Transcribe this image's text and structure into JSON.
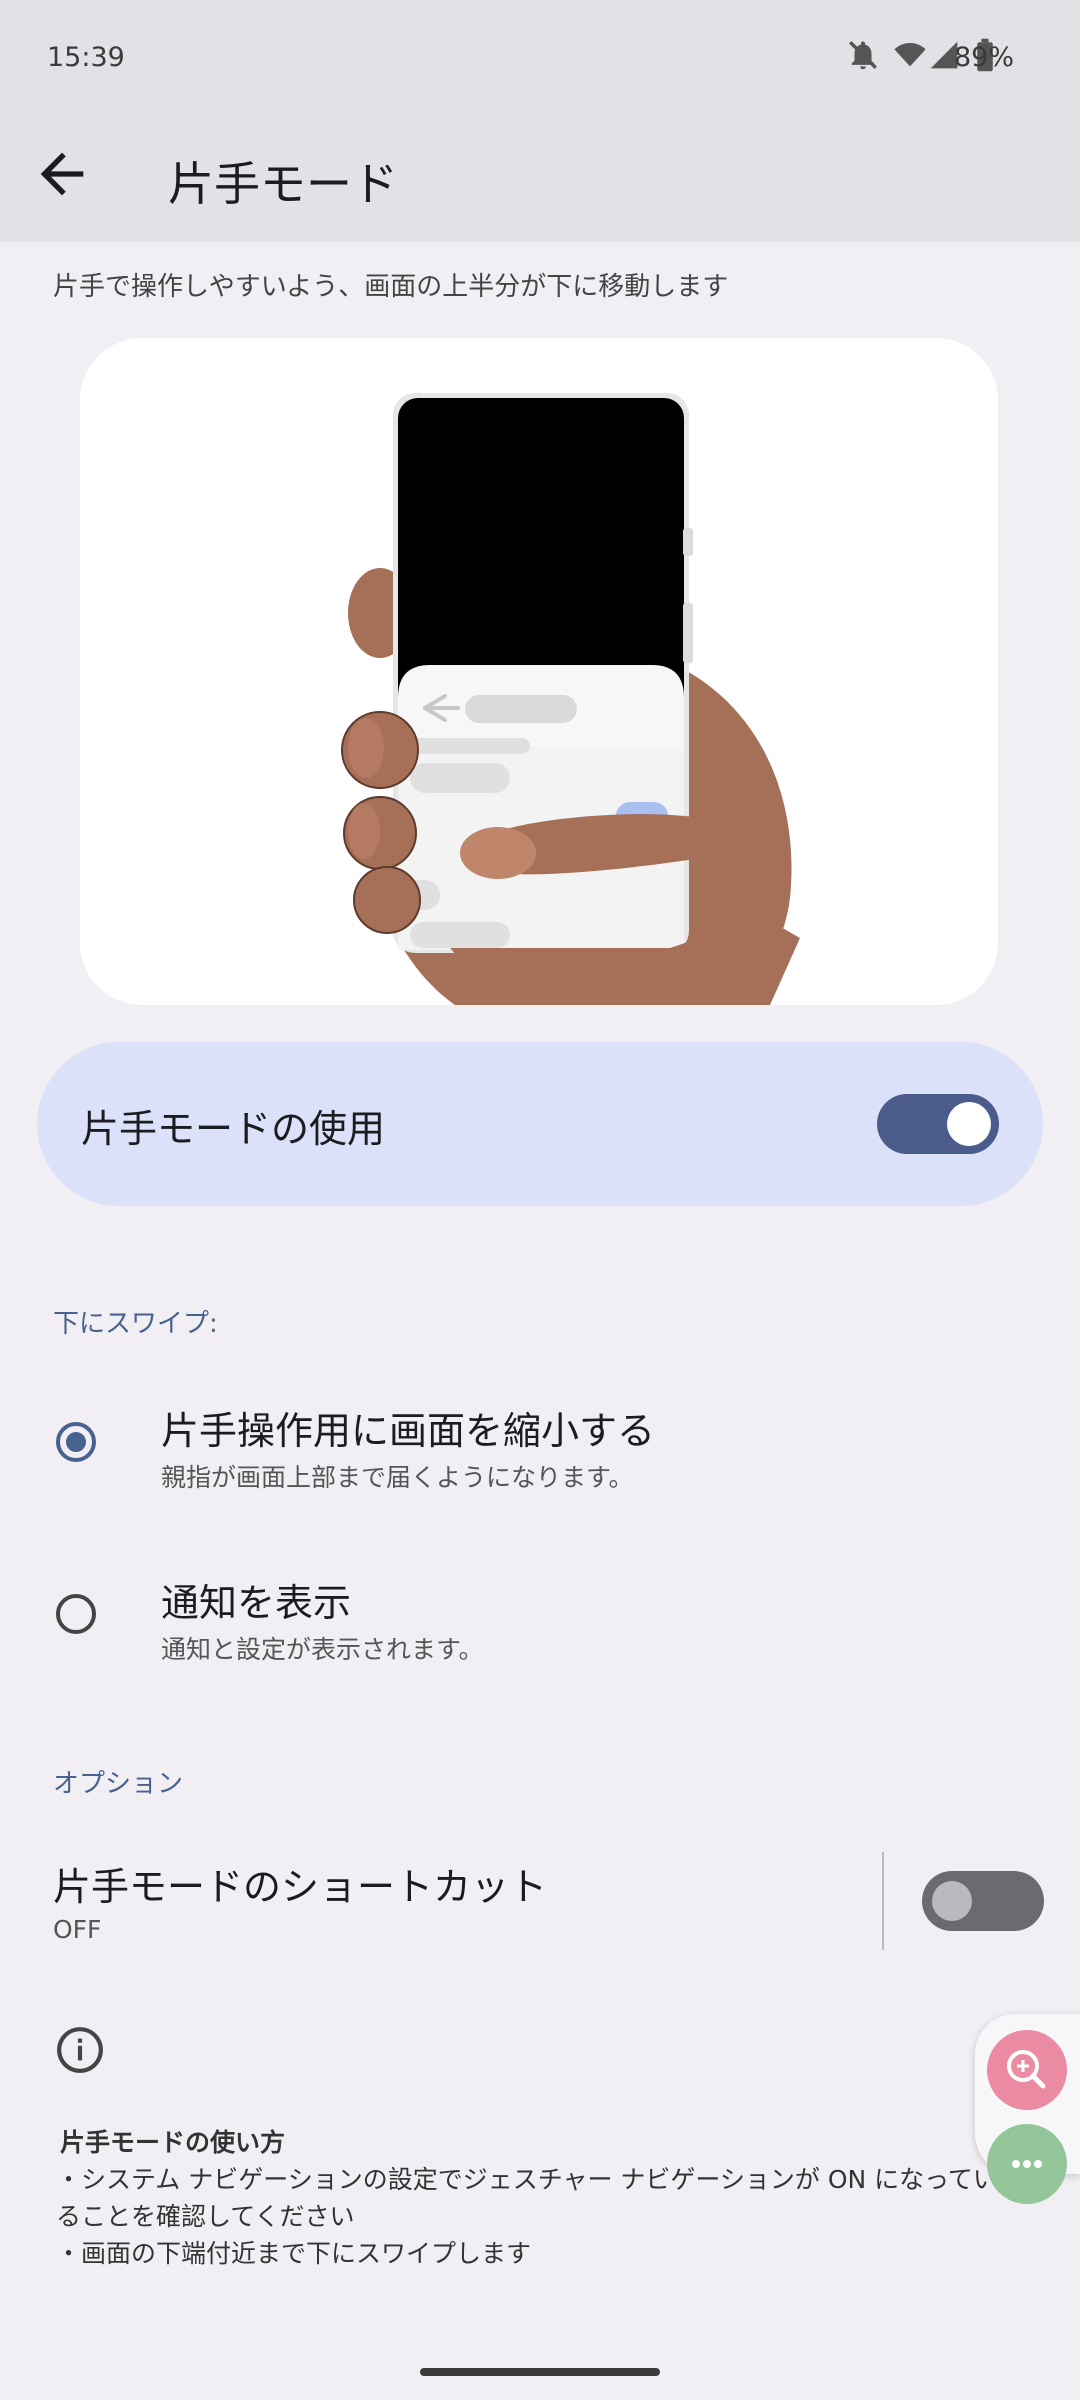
{
  "status_bar": {
    "time": "15:39",
    "battery": "89%"
  },
  "app_bar": {
    "title": "片手モード"
  },
  "description": "片手で操作しやすいよう、画面の上半分が下に移動します",
  "main_toggle": {
    "label": "片手モードの使用",
    "checked": true
  },
  "swipe_section": {
    "header": "下にスワイプ:",
    "options": [
      {
        "title": "片手操作用に画面を縮小する",
        "subtitle": "親指が画面上部まで届くようになります。",
        "selected": true
      },
      {
        "title": "通知を表示",
        "subtitle": "通知と設定が表示されます。",
        "selected": false
      }
    ]
  },
  "options_section": {
    "header": "オプション",
    "shortcut": {
      "title": "片手モードのショートカット",
      "state": "OFF",
      "checked": false
    }
  },
  "help": {
    "title": "片手モードの使い方",
    "lines": [
      "・システム ナビゲーションの設定でジェスチャー ナビゲーションが ON になってい",
      "ることを確認してください",
      "・画面の下端付近まで下にスワイプします"
    ]
  },
  "colors": {
    "accent": "#48628f",
    "toggle_card": "#dae1f8",
    "switch_on": "#4a5b8c",
    "fab_zoom": "#ea8aa3",
    "fab_more": "#93c79a"
  },
  "icons": {
    "back": "arrow-back-icon",
    "info": "info-icon",
    "zoom": "zoom-in-icon",
    "more": "more-horiz-icon"
  }
}
